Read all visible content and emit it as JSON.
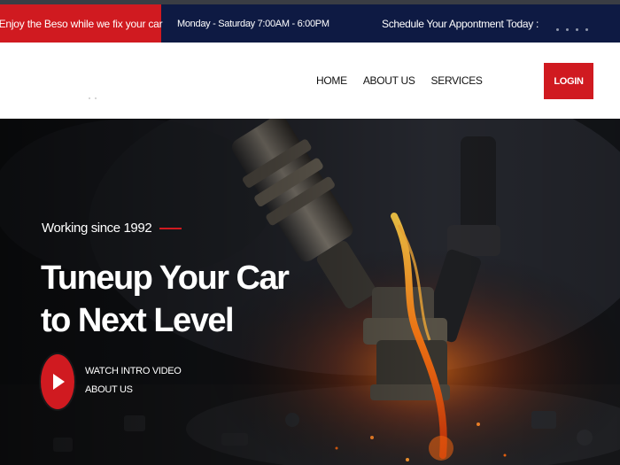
{
  "topbar": {
    "promo": "Enjoy the Beso while we fix your car",
    "hours": "Monday - Saturday 7:00AM - 6:00PM",
    "schedule": "Schedule Your Appontment Today :"
  },
  "nav": {
    "links": [
      "HOME",
      "ABOUT US",
      "SERVICES"
    ],
    "login": "LOGIN"
  },
  "hero": {
    "tagline": "Working since 1992",
    "headline_line1": "Tuneup Your Car",
    "headline_line2": "to Next Level",
    "video_label": "WATCH INTRO VIDEO",
    "about_label": "ABOUT US",
    "play_icon": "play-icon"
  },
  "colors": {
    "brand_red": "#d01a20",
    "topbar_navy": "#0e1a43",
    "white": "#ffffff"
  }
}
